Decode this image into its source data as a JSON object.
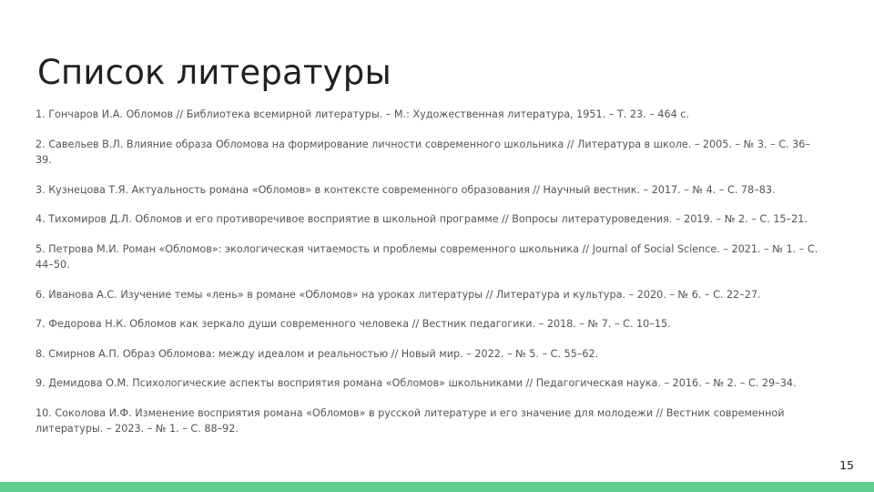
{
  "slide": {
    "title": "Список литературы",
    "page_number": "15",
    "accent_color": "#5ecf91"
  },
  "references": [
    "1. Гончаров И.А. Обломов // Библиотека всемирной литературы. – М.: Художественная литература, 1951. – Т. 23. – 464 с.",
    "2. Савельев В.Л. Влияние образа Обломова на формирование личности современного школьника // Литература в школе. – 2005. – № 3. – С. 36–39.",
    "3. Кузнецова Т.Я. Актуальность романа «Обломов» в контексте современного образования // Научный вестник. – 2017. – № 4. – С. 78–83.",
    "4. Тихомиров Д.Л. Обломов и его противоречивое восприятие в школьной программе // Вопросы литературоведения. – 2019. – № 2. – С. 15–21.",
    "5. Петрова М.И. Роман «Обломов»: экологическая читаемость и проблемы современного школьника // Journal of Social Science. – 2021. – № 1. – С. 44–50.",
    "6. Иванова А.С. Изучение темы «лень» в романе «Обломов» на уроках литературы // Литература и культура. – 2020. – № 6. – С. 22–27.",
    "7. Федорова Н.К. Обломов как зеркало души современного человека // Вестник педагогики. – 2018. – № 7. – С. 10–15.",
    "8. Смирнов А.П. Образ Обломова: между идеалом и реальностью // Новый мир. – 2022. – № 5. – С. 55–62.",
    "9. Демидова О.М. Психологические аспекты восприятия романа «Обломов» школьниками // Педагогическая наука. – 2016. – № 2. – С. 29–34.",
    "10. Соколова И.Ф. Изменение восприятия романа «Обломов» в русской литературе и его значение для молодежи // Вестник современной литературы. – 2023. – № 1. – С. 88–92."
  ]
}
